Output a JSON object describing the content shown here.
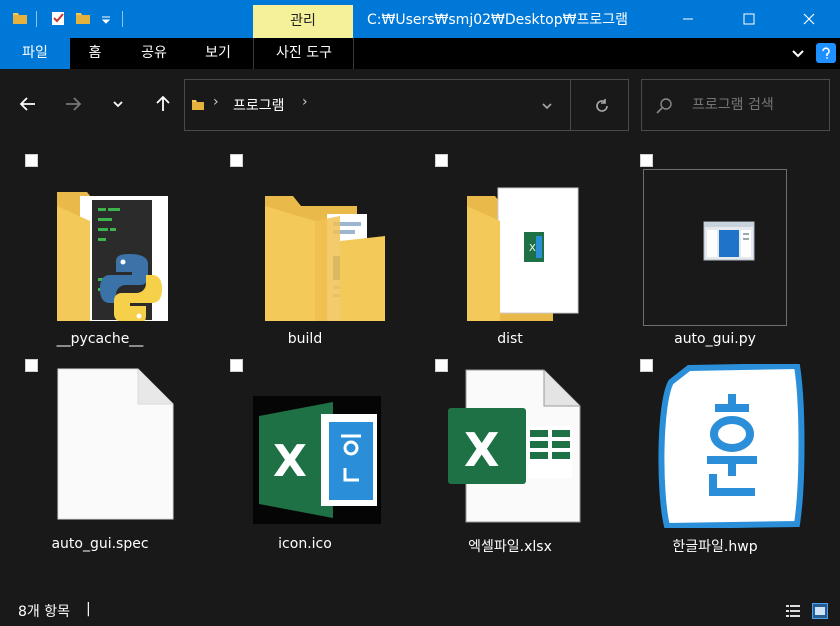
{
  "title_bar": {
    "manage_tab": "관리",
    "path": "C:₩Users₩smj02₩Desktop₩프로그램",
    "minimize": "—",
    "maximize": "☐",
    "close": "✕"
  },
  "ribbon": {
    "tabs": [
      "파일",
      "홈",
      "공유",
      "보기",
      "사진 도구"
    ]
  },
  "address": {
    "chevron": "›",
    "current": "프로그램",
    "trailing_chevron": "›"
  },
  "search": {
    "placeholder": "프로그램 검색"
  },
  "files": [
    {
      "name": "__pycache__",
      "type": "folder-python"
    },
    {
      "name": "build",
      "type": "folder-docs"
    },
    {
      "name": "dist",
      "type": "folder-app"
    },
    {
      "name": "auto_gui.py",
      "type": "py-file"
    },
    {
      "name": "auto_gui.spec",
      "type": "blank-file"
    },
    {
      "name": "icon.ico",
      "type": "ico-file"
    },
    {
      "name": "엑셀파일.xlsx",
      "type": "excel-file"
    },
    {
      "name": "한글파일.hwp",
      "type": "hwp-file"
    }
  ],
  "status": {
    "item_count": "8개 항목",
    "cursor": "|"
  },
  "colors": {
    "accent": "#0078d7",
    "manage_tab": "#f4f19a",
    "folder": "#f3c95a",
    "excel_green": "#1e7145",
    "hwp_blue": "#2a8fd8"
  }
}
